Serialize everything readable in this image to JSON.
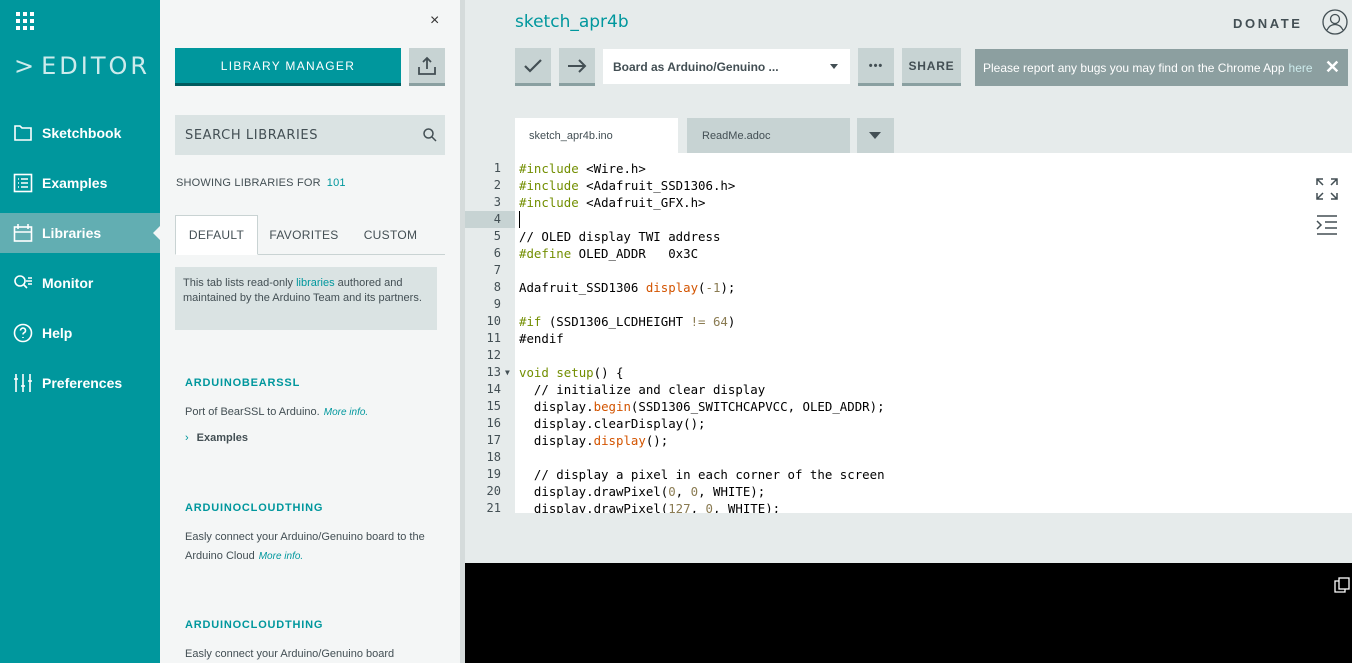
{
  "nav": {
    "logo": "EDITOR",
    "items": [
      {
        "label": "Sketchbook",
        "icon": "folder-icon"
      },
      {
        "label": "Examples",
        "icon": "list-icon"
      },
      {
        "label": "Libraries",
        "icon": "libraries-icon",
        "active": true
      },
      {
        "label": "Monitor",
        "icon": "monitor-icon"
      },
      {
        "label": "Help",
        "icon": "help-icon"
      },
      {
        "label": "Preferences",
        "icon": "sliders-icon"
      }
    ]
  },
  "panel": {
    "close": "×",
    "library_manager": "LIBRARY MANAGER",
    "search_placeholder": "SEARCH LIBRARIES",
    "showing_label": "SHOWING LIBRARIES FOR",
    "showing_count": "101",
    "tabs": [
      "DEFAULT",
      "FAVORITES",
      "CUSTOM"
    ],
    "info_pre": "This tab lists read-only ",
    "info_link": "libraries",
    "info_post": " authored and maintained by the Arduino Team and its partners.",
    "libraries": [
      {
        "name": "ARDUINOBEARSSL",
        "desc": "Port of BearSSL to Arduino.",
        "more": "More info.",
        "examples": "Examples"
      },
      {
        "name": "ARDUINOCLOUDTHING",
        "desc": "Easly connect your Arduino/Genuino board to the Arduino Cloud",
        "more": "More info."
      },
      {
        "name": "ARDUINOCLOUDTHING",
        "desc": "Easly connect your Arduino/Genuino board"
      }
    ]
  },
  "header": {
    "sketch_name": "sketch_apr4b",
    "donate": "DONATE",
    "board": "Board as Arduino/Genuino ...",
    "more": "•••",
    "share": "SHARE",
    "banner_text": "Please report any bugs you may find on the Chrome App",
    "banner_link": "here",
    "banner_close": "✕"
  },
  "file_tabs": [
    "sketch_apr4b.ino",
    "ReadMe.adoc"
  ],
  "code": {
    "line_numbers": [
      "1",
      "2",
      "3",
      "4",
      "5",
      "6",
      "7",
      "8",
      "9",
      "10",
      "11",
      "12",
      "13",
      "14",
      "15",
      "16",
      "17",
      "18",
      "19",
      "20",
      "21"
    ],
    "l1a": "#include",
    "l1b": " <Wire.h>",
    "l2a": "#include",
    "l2b": " <Adafruit_SSD1306.h>",
    "l3a": "#include",
    "l3b": " <Adafruit_GFX.h>",
    "l5": "// OLED display TWI address",
    "l6a": "#define",
    "l6b": " OLED_ADDR   0x3C",
    "l8a": "Adafruit_SSD1306 ",
    "l8b": "display",
    "l8c": "(",
    "l8d": "-1",
    "l8e": ");",
    "l10a": "#if",
    "l10b": " (SSD1306_LCDHEIGHT ",
    "l10c": "!= 64",
    "l10d": ")",
    "l11": "#endif",
    "l13a": "void",
    "l13b": " ",
    "l13c": "setup",
    "l13d": "() {",
    "l14": "  // initialize and clear display",
    "l15a": "  display.",
    "l15b": "begin",
    "l15c": "(SSD1306_SWITCHCAPVCC, OLED_ADDR);",
    "l16": "  display.clearDisplay();",
    "l17a": "  display.",
    "l17b": "display",
    "l17c": "();",
    "l19": "  // display a pixel in each corner of the screen",
    "l20a": "  display.drawPixel(",
    "l20b": "0",
    "l20c": ", ",
    "l20d": "0",
    "l20e": ", WHITE);",
    "l21a": "  display.drawPixel(",
    "l21b": "127",
    "l21c": ", ",
    "l21d": "0",
    "l21e": ", WHITE);"
  }
}
